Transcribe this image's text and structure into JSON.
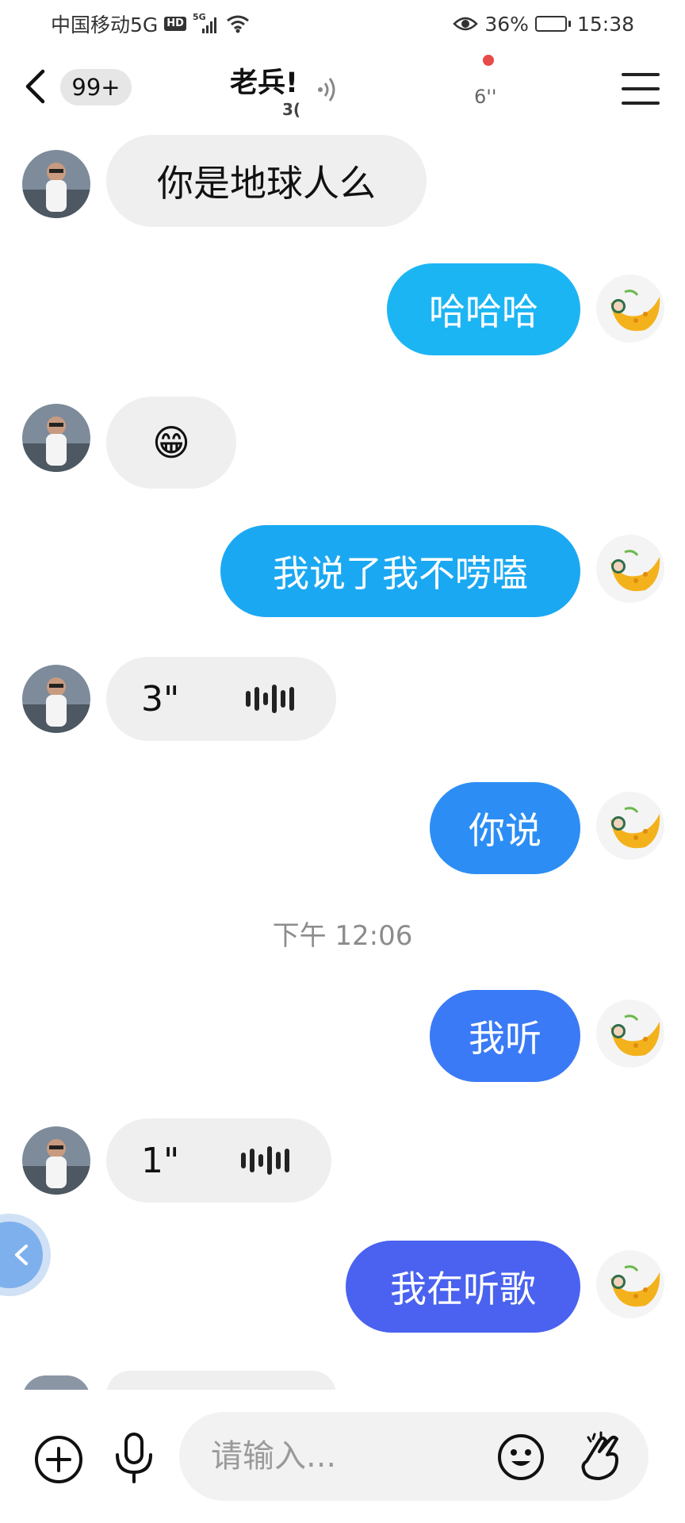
{
  "status_bar": {
    "carrier": "中国移动5G",
    "hd_badge": "HD",
    "signal_label": "5G",
    "battery": "36%",
    "battery_level": 0.36,
    "time": "15:38"
  },
  "header": {
    "unread_count": "99+",
    "title": "老兵!",
    "subtitle": "3(",
    "duration": "6''"
  },
  "messages": {
    "m1": {
      "sender": "other",
      "text": "你是地球人么"
    },
    "m2": {
      "sender": "self",
      "text": "哈哈哈",
      "color": "#1cb5f4"
    },
    "m3": {
      "sender": "other",
      "text": "😁"
    },
    "m4": {
      "sender": "self",
      "text": "我说了我不唠嗑",
      "color": "#1ba8f2"
    },
    "m5": {
      "sender": "other",
      "duration": "3\""
    },
    "m6": {
      "sender": "self",
      "text": "你说",
      "color": "#2c8ef4"
    },
    "timestamp": "下午 12:06",
    "m7": {
      "sender": "self",
      "text": "我听",
      "color": "#3b7af6"
    },
    "m8": {
      "sender": "other",
      "duration": "1\""
    },
    "m9": {
      "sender": "self",
      "text": "我在听歌",
      "color": "#4a62ef"
    }
  },
  "input": {
    "placeholder": "请输入..."
  },
  "colors": {
    "other_bubble": "#efefef",
    "timestamp": "#8c8c8c"
  }
}
